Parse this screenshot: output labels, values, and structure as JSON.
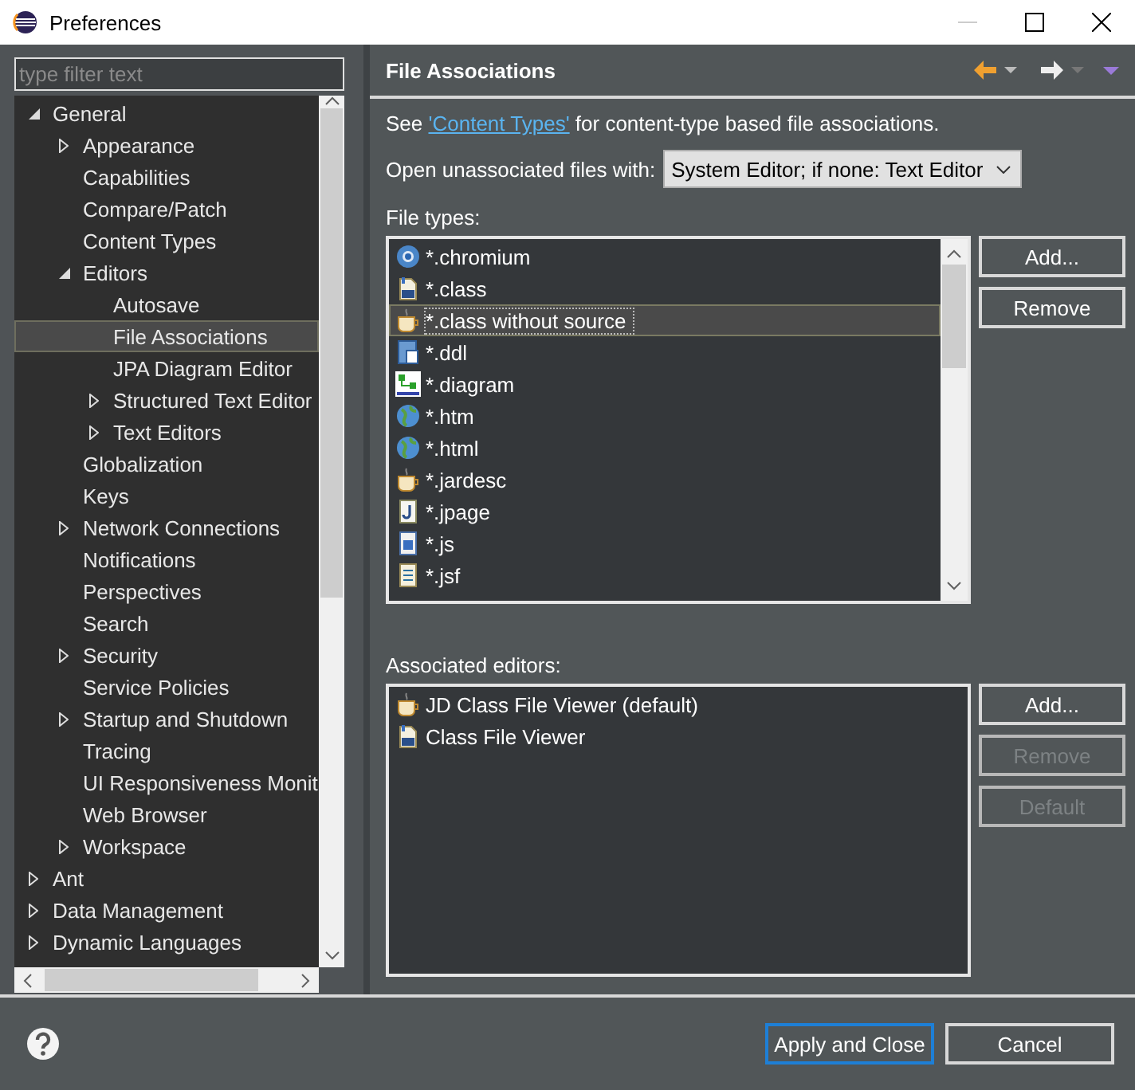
{
  "window": {
    "title": "Preferences",
    "minimize_disabled": true
  },
  "filter": {
    "placeholder": "type filter text"
  },
  "tree": {
    "items": [
      {
        "label": "General",
        "expanded": true,
        "selected": false,
        "children": [
          {
            "label": "Appearance",
            "expanded": false,
            "selected": false
          },
          {
            "label": "Capabilities",
            "selected": false
          },
          {
            "label": "Compare/Patch",
            "selected": false
          },
          {
            "label": "Content Types",
            "selected": false
          },
          {
            "label": "Editors",
            "expanded": true,
            "selected": false,
            "children": [
              {
                "label": "Autosave",
                "selected": false
              },
              {
                "label": "File Associations",
                "selected": true
              },
              {
                "label": "JPA Diagram Editor",
                "selected": false
              },
              {
                "label": "Structured Text Editor",
                "expanded": false,
                "selected": false
              },
              {
                "label": "Text Editors",
                "expanded": false,
                "selected": false
              }
            ]
          },
          {
            "label": "Globalization",
            "selected": false
          },
          {
            "label": "Keys",
            "selected": false
          },
          {
            "label": "Network Connections",
            "expanded": false,
            "selected": false
          },
          {
            "label": "Notifications",
            "selected": false
          },
          {
            "label": "Perspectives",
            "selected": false
          },
          {
            "label": "Search",
            "selected": false
          },
          {
            "label": "Security",
            "expanded": false,
            "selected": false
          },
          {
            "label": "Service Policies",
            "selected": false
          },
          {
            "label": "Startup and Shutdown",
            "expanded": false,
            "selected": false
          },
          {
            "label": "Tracing",
            "selected": false
          },
          {
            "label": "UI Responsiveness Monit",
            "selected": false
          },
          {
            "label": "Web Browser",
            "selected": false
          },
          {
            "label": "Workspace",
            "expanded": false,
            "selected": false
          }
        ]
      },
      {
        "label": "Ant",
        "expanded": false,
        "selected": false
      },
      {
        "label": "Data Management",
        "expanded": false,
        "selected": false
      },
      {
        "label": "Dynamic Languages",
        "expanded": false,
        "selected": false
      }
    ]
  },
  "page": {
    "title": "File Associations"
  },
  "note": {
    "before": "See ",
    "link": "'Content Types'",
    "after": " for content-type based file associations."
  },
  "open_with": {
    "label": "Open unassociated files with:",
    "value": "System Editor; if none: Text Editor"
  },
  "file_types": {
    "label": "File types:",
    "items": [
      {
        "kind": "chromium",
        "label": "*.chromium",
        "selected": false
      },
      {
        "kind": "classfile",
        "label": "*.class",
        "selected": false
      },
      {
        "kind": "cup",
        "label": "*.class without source",
        "selected": true
      },
      {
        "kind": "ddl",
        "label": "*.ddl",
        "selected": false
      },
      {
        "kind": "diagram",
        "label": "*.diagram",
        "selected": false
      },
      {
        "kind": "globe",
        "label": "*.htm",
        "selected": false
      },
      {
        "kind": "globe",
        "label": "*.html",
        "selected": false
      },
      {
        "kind": "cup",
        "label": "*.jardesc",
        "selected": false
      },
      {
        "kind": "jpage",
        "label": "*.jpage",
        "selected": false
      },
      {
        "kind": "js",
        "label": "*.js",
        "selected": false
      },
      {
        "kind": "doc",
        "label": "*.jsf",
        "selected": false
      }
    ],
    "buttons": [
      {
        "label": "Add...",
        "disabled": false
      },
      {
        "label": "Remove",
        "disabled": false
      }
    ]
  },
  "associated_editors": {
    "label": "Associated editors:",
    "items": [
      {
        "kind": "cup",
        "label": "JD Class File Viewer (default)",
        "selected": false
      },
      {
        "kind": "classfile",
        "label": "Class File Viewer",
        "selected": false
      }
    ],
    "buttons": [
      {
        "label": "Add...",
        "disabled": false
      },
      {
        "label": "Remove",
        "disabled": true
      },
      {
        "label": "Default",
        "disabled": true
      }
    ]
  },
  "footer": {
    "buttons": [
      {
        "label": "Apply and Close",
        "default": true
      },
      {
        "label": "Cancel",
        "default": false
      }
    ]
  }
}
